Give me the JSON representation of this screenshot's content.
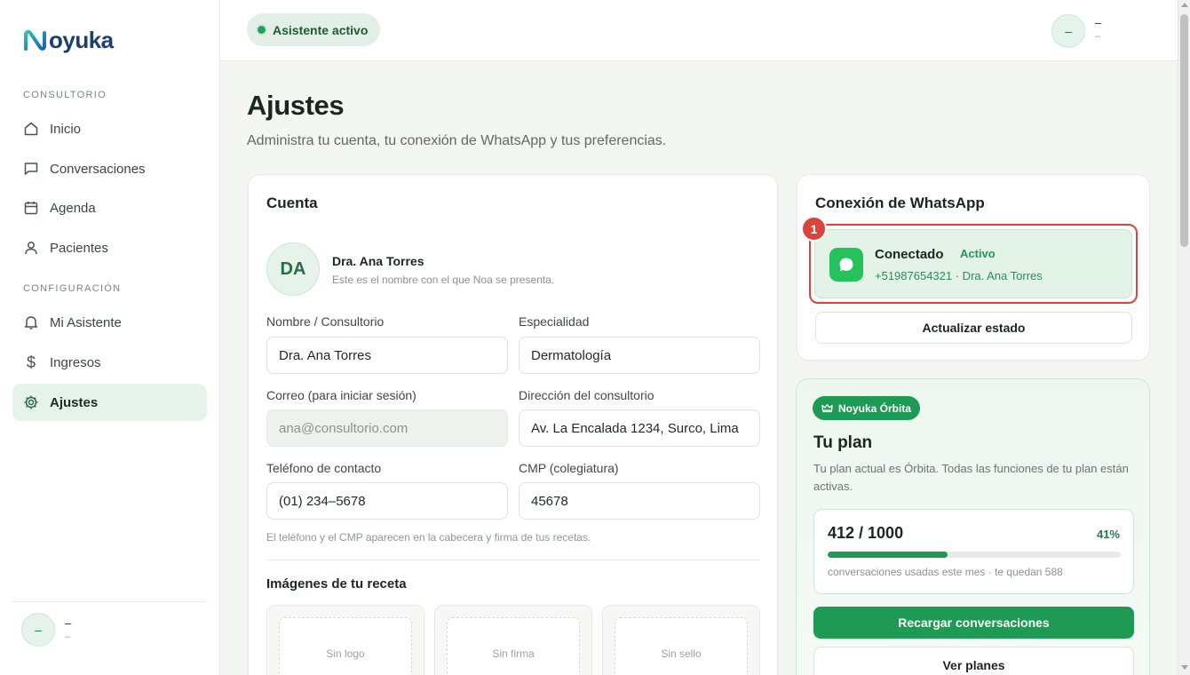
{
  "brand": {
    "name": "oyuka",
    "logo_letter": "N"
  },
  "sidebar": {
    "section_consultorio": "CONSULTORIO",
    "section_configuracion": "CONFIGURACIÓN",
    "items": [
      {
        "label": "Inicio",
        "icon": "home-icon"
      },
      {
        "label": "Conversaciones",
        "icon": "chat-icon"
      },
      {
        "label": "Agenda",
        "icon": "calendar-icon"
      },
      {
        "label": "Pacientes",
        "icon": "user-icon"
      },
      {
        "label": "Mi Asistente",
        "icon": "bell-icon"
      },
      {
        "label": "Ingresos",
        "icon": "dollar-icon"
      },
      {
        "label": "Ajustes",
        "icon": "gear-icon",
        "active": true
      }
    ],
    "user": {
      "initials": "–",
      "name": "–",
      "sub": "–"
    }
  },
  "topbar": {
    "assistant_status": "Asistente activo",
    "user": {
      "initials": "–",
      "name": "–",
      "sub": "–"
    }
  },
  "page": {
    "title": "Ajustes",
    "subtitle": "Administra tu cuenta, tu conexión de WhatsApp y tus preferencias."
  },
  "account": {
    "title": "Cuenta",
    "initials": "DA",
    "display_name": "Dra. Ana Torres",
    "display_desc": "Este es el nombre con el que Noa se presenta.",
    "fields": {
      "name_label": "Nombre / Consultorio",
      "name_value": "Dra. Ana Torres",
      "specialty_label": "Especialidad",
      "specialty_value": "Dermatología",
      "email_label": "Correo (para iniciar sesión)",
      "email_value": "ana@consultorio.com",
      "address_label": "Dirección del consultorio",
      "address_value": "Av. La Encalada 1234, Surco, Lima",
      "phone_label": "Teléfono de contacto",
      "phone_value": "(01) 234–5678",
      "cmp_label": "CMP (colegiatura)",
      "cmp_value": "45678"
    },
    "fields_note": "El teléfono y el CMP aparecen en la cabecera y firma de tus recetas.",
    "images_title": "Imágenes de tu receta",
    "image_slots": [
      "Sin logo",
      "Sin firma",
      "Sin sello"
    ]
  },
  "whatsapp": {
    "title": "Conexión de WhatsApp",
    "step_number": "1",
    "status": "Conectado",
    "badge": "Activo",
    "phone_line": "+51987654321 · Dra. Ana Torres",
    "refresh_button": "Actualizar estado",
    "accent_color": "#25c25c",
    "highlight_color": "#d8453b"
  },
  "plan": {
    "chip": "Noyuka Órbita",
    "title": "Tu plan",
    "description": "Tu plan actual es Órbita. Todas las funciones de tu plan están activas.",
    "usage_count": "412 / 1000",
    "usage_percent": "41%",
    "usage_fraction": 0.41,
    "usage_note": "conversaciones usadas este mes · te quedan 588",
    "recharge_button": "Recargar conversaciones",
    "plans_button": "Ver planes",
    "accent_color": "#1e9a55"
  }
}
